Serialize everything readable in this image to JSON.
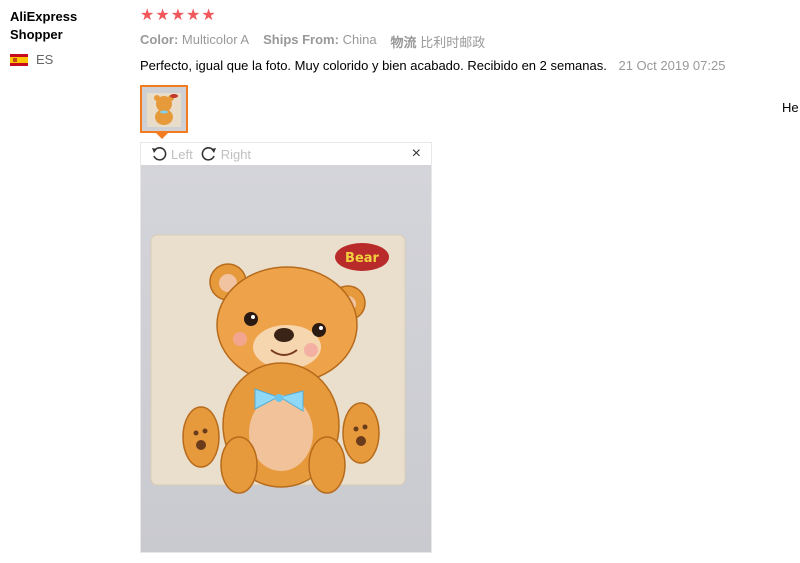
{
  "reviewer": {
    "name_line1": "AliExpress",
    "name_line2": "Shopper",
    "country_code": "ES"
  },
  "review": {
    "rating": 5,
    "stars": [
      "★",
      "★",
      "★",
      "★",
      "★"
    ],
    "attributes": [
      {
        "key": "Color:",
        "value": "Multicolor A"
      },
      {
        "key": "Ships From:",
        "value": "China"
      },
      {
        "key": "物流",
        "value": "比利时邮政"
      }
    ],
    "text": "Perfecto, igual que la foto. Muy colorido y bien acabado. Recibido en 2 semanas.",
    "date": "21 Oct 2019 07:25",
    "cut_text": "He"
  },
  "image_viewer": {
    "rotate_left_label": "Left",
    "rotate_right_label": "Right",
    "close_symbol": "×",
    "puzzle_label": "Bear"
  },
  "colors": {
    "star": "#f0585c",
    "accent_border": "#f47c20",
    "muted_text": "#999999"
  }
}
